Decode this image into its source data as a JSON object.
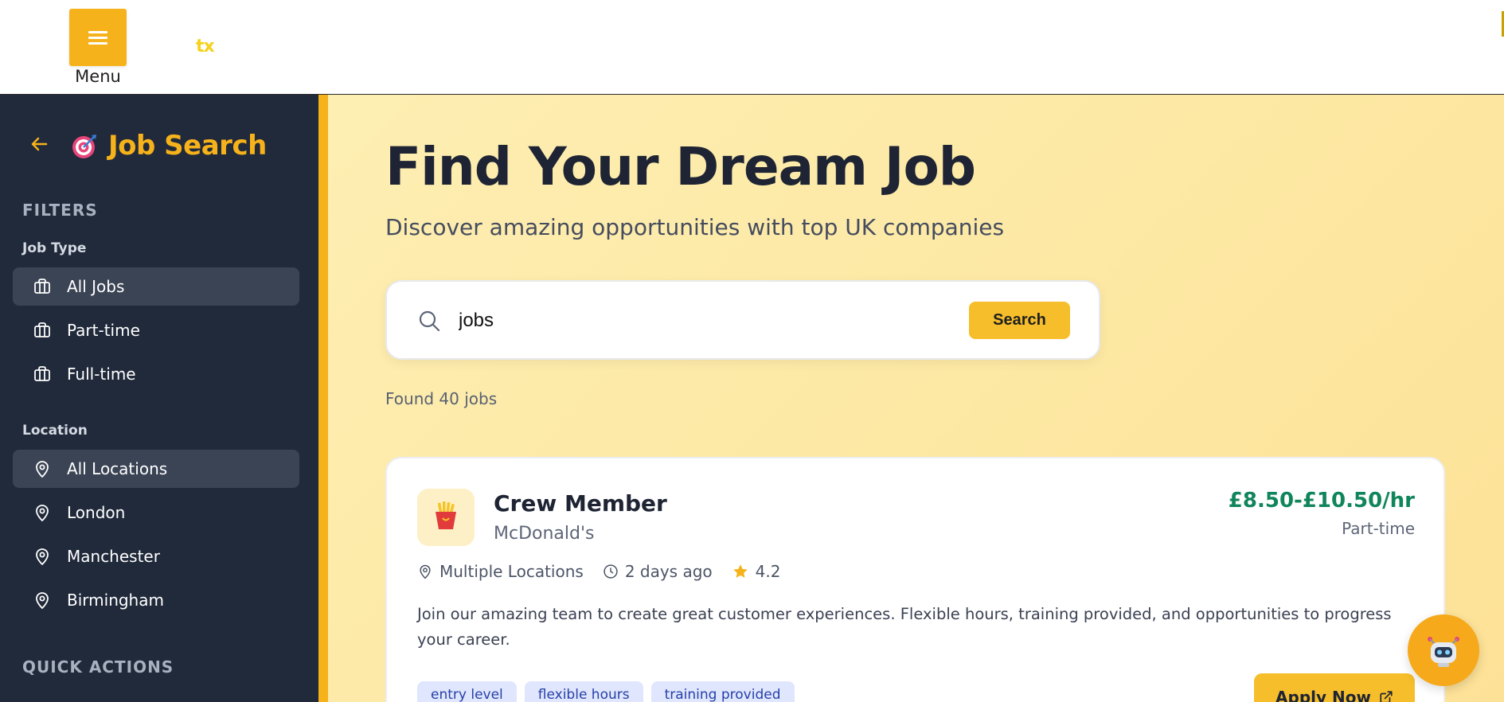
{
  "topbar": {
    "menu_label": "Menu",
    "brand": "tx"
  },
  "sidebar": {
    "title": "Job Search",
    "filters_heading": "FILTERS",
    "job_type_heading": "Job Type",
    "job_types": [
      {
        "label": "All Jobs",
        "active": true
      },
      {
        "label": "Part-time",
        "active": false
      },
      {
        "label": "Full-time",
        "active": false
      }
    ],
    "location_heading": "Location",
    "locations": [
      {
        "label": "All Locations",
        "active": true
      },
      {
        "label": "London",
        "active": false
      },
      {
        "label": "Manchester",
        "active": false
      },
      {
        "label": "Birmingham",
        "active": false
      }
    ],
    "quick_actions_heading": "QUICK ACTIONS"
  },
  "main": {
    "title": "Find Your Dream Job",
    "subtitle": "Discover amazing opportunities with top UK companies",
    "search": {
      "value": "jobs",
      "button_label": "Search"
    },
    "found_text": "Found 40 jobs",
    "jobs": [
      {
        "title": "Crew Member",
        "company": "McDonald's",
        "logo_icon": "fries-icon",
        "salary": "£8.50-£10.50/hr",
        "type": "Part-time",
        "location": "Multiple Locations",
        "posted": "2 days ago",
        "rating": "4.2",
        "description": "Join our amazing team to create great customer experiences. Flexible hours, training provided, and opportunities to progress your career.",
        "tags": [
          "entry level",
          "flexible hours",
          "training provided"
        ],
        "apply_label": "Apply Now"
      }
    ]
  },
  "colors": {
    "accent": "#f6b21a",
    "sidebar_bg": "#212a3b",
    "salary_green": "#10855c",
    "tag_bg": "#dfe6fd"
  }
}
